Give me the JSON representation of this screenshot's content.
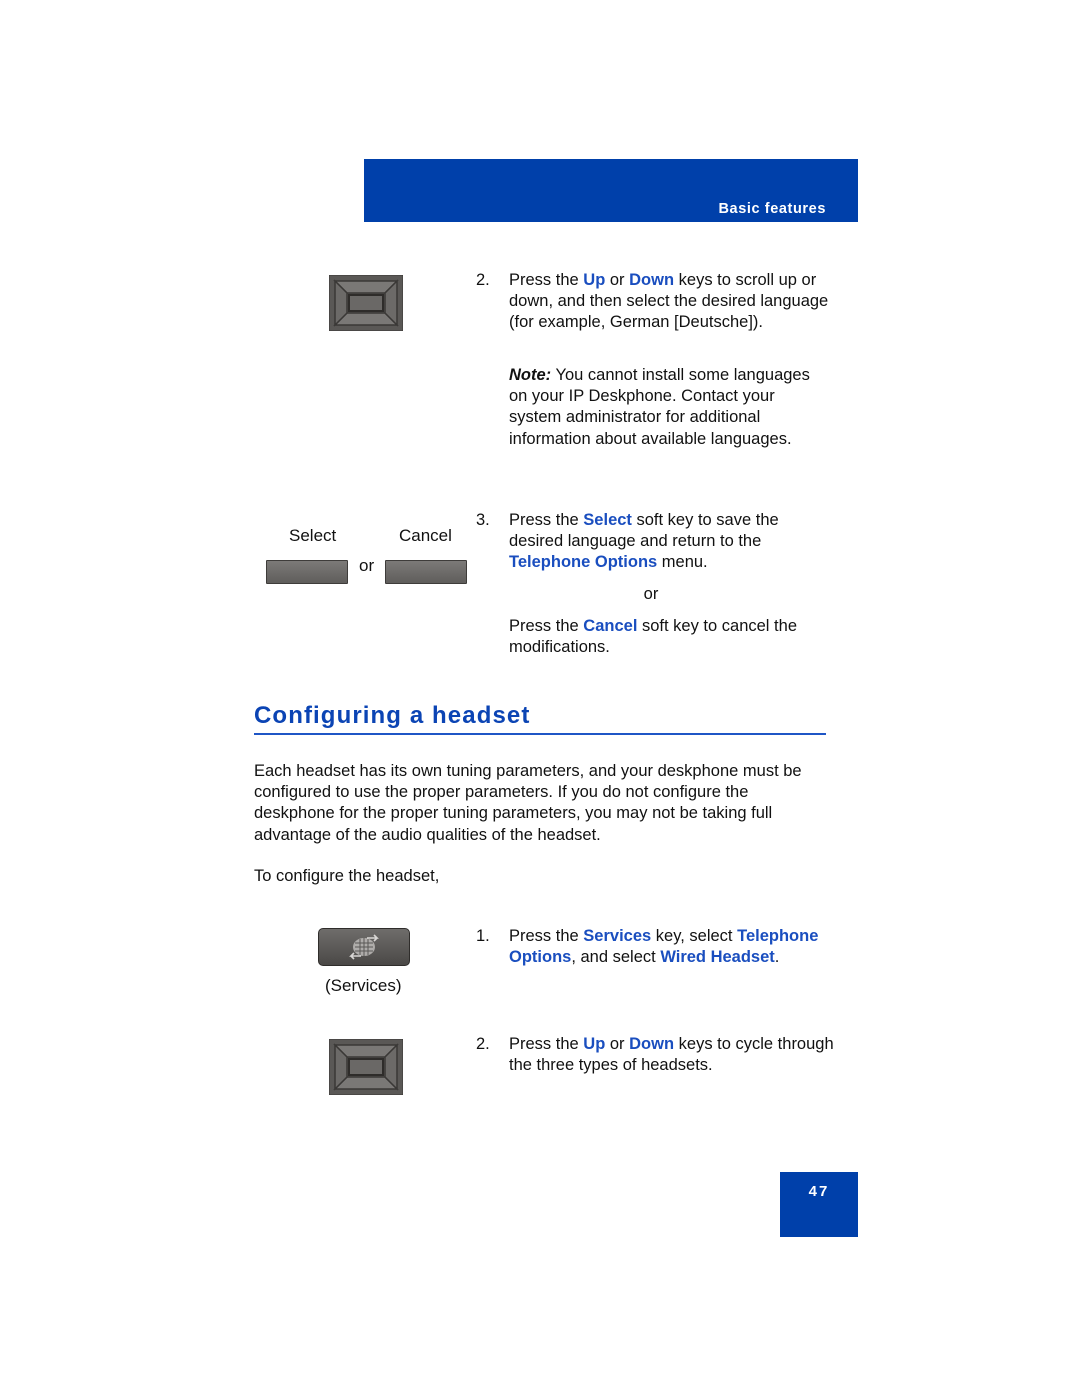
{
  "header": {
    "section_label": "Basic features",
    "accent_color": "#0040aa"
  },
  "icons": {
    "nav_key_top": "navigation-cluster-icon",
    "select_softkey": "select-softkey-icon",
    "cancel_softkey": "cancel-softkey-icon",
    "services_key": "services-key-icon",
    "nav_key_bottom": "navigation-cluster-icon"
  },
  "softkeys": {
    "select_label": "Select",
    "cancel_label": "Cancel",
    "or_label": "or"
  },
  "language_steps": {
    "step2": {
      "num": "2.",
      "t1": "Press the ",
      "up": "Up",
      "t2": " or ",
      "down": "Down",
      "t3": " keys to scroll up or down, and then select the desired language (for example, German [Deutsche])."
    },
    "note": {
      "label": "Note:",
      "text": " You cannot install some languages on your IP Deskphone. Contact your system administrator for additional information about available languages."
    },
    "step3": {
      "num": "3.",
      "t1": "Press the ",
      "select": "Select",
      "t2": " soft key to save the desired language and return to the ",
      "telephone_options": "Telephone Options",
      "t3": " menu."
    },
    "or": "or",
    "cancel_para": {
      "t1": "Press the ",
      "cancel": "Cancel",
      "t2": " soft key to cancel the modifications."
    }
  },
  "section": {
    "title": "Configuring a headset",
    "intro": "Each headset has its own tuning parameters, and your deskphone must be configured to use the proper parameters. If you do not configure the deskphone for the proper tuning parameters, you may not be taking full advantage of the audio qualities of the headset.",
    "lead_in": "To configure the headset,",
    "services_caption": "(Services)",
    "step1": {
      "num": "1.",
      "t1": "Press the ",
      "services": "Services",
      "t2": " key, select ",
      "telephone_options": "Telephone Options",
      "t3": ", and select ",
      "wired_headset": "Wired Headset",
      "t4": "."
    },
    "step2": {
      "num": "2.",
      "t1": "Press the ",
      "up": "Up",
      "t2": " or ",
      "down": "Down",
      "t3": " keys to cycle through the three types of headsets."
    }
  },
  "footer": {
    "page_number": "47"
  }
}
